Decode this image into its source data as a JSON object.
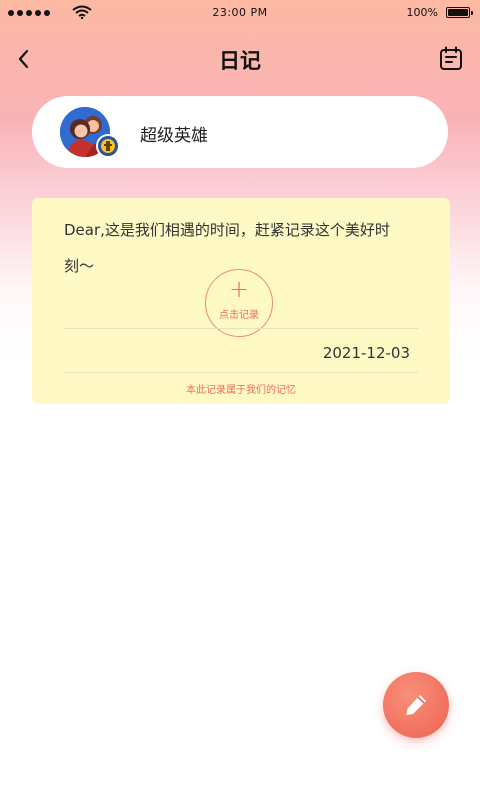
{
  "status_bar": {
    "time": "23:00 PM",
    "battery_percent": "100%",
    "signal_icon": "signal-dots-icon",
    "wifi_icon": "wifi-icon",
    "battery_icon": "battery-icon"
  },
  "nav": {
    "title": "日记",
    "back_icon": "chevron-left-icon",
    "calendar_icon": "calendar-icon"
  },
  "profile": {
    "name": "超级英雄",
    "avatar_icon": "avatar",
    "badge_icon": "badge-icon"
  },
  "diary": {
    "text": "Dear,这是我们相遇的时间，赶紧记录这个美好时刻～",
    "record_button_label": "点击记录",
    "record_icon": "plus-icon",
    "date": "2021-12-03",
    "footer": "本此记录属于我们的记忆"
  },
  "fab": {
    "icon": "pencil-icon"
  },
  "colors": {
    "accent": "#ef6e55",
    "card_background": "#fff9c6",
    "header_gradient_top": "#fdb9a2",
    "header_gradient_mid": "#f9b3b8"
  }
}
